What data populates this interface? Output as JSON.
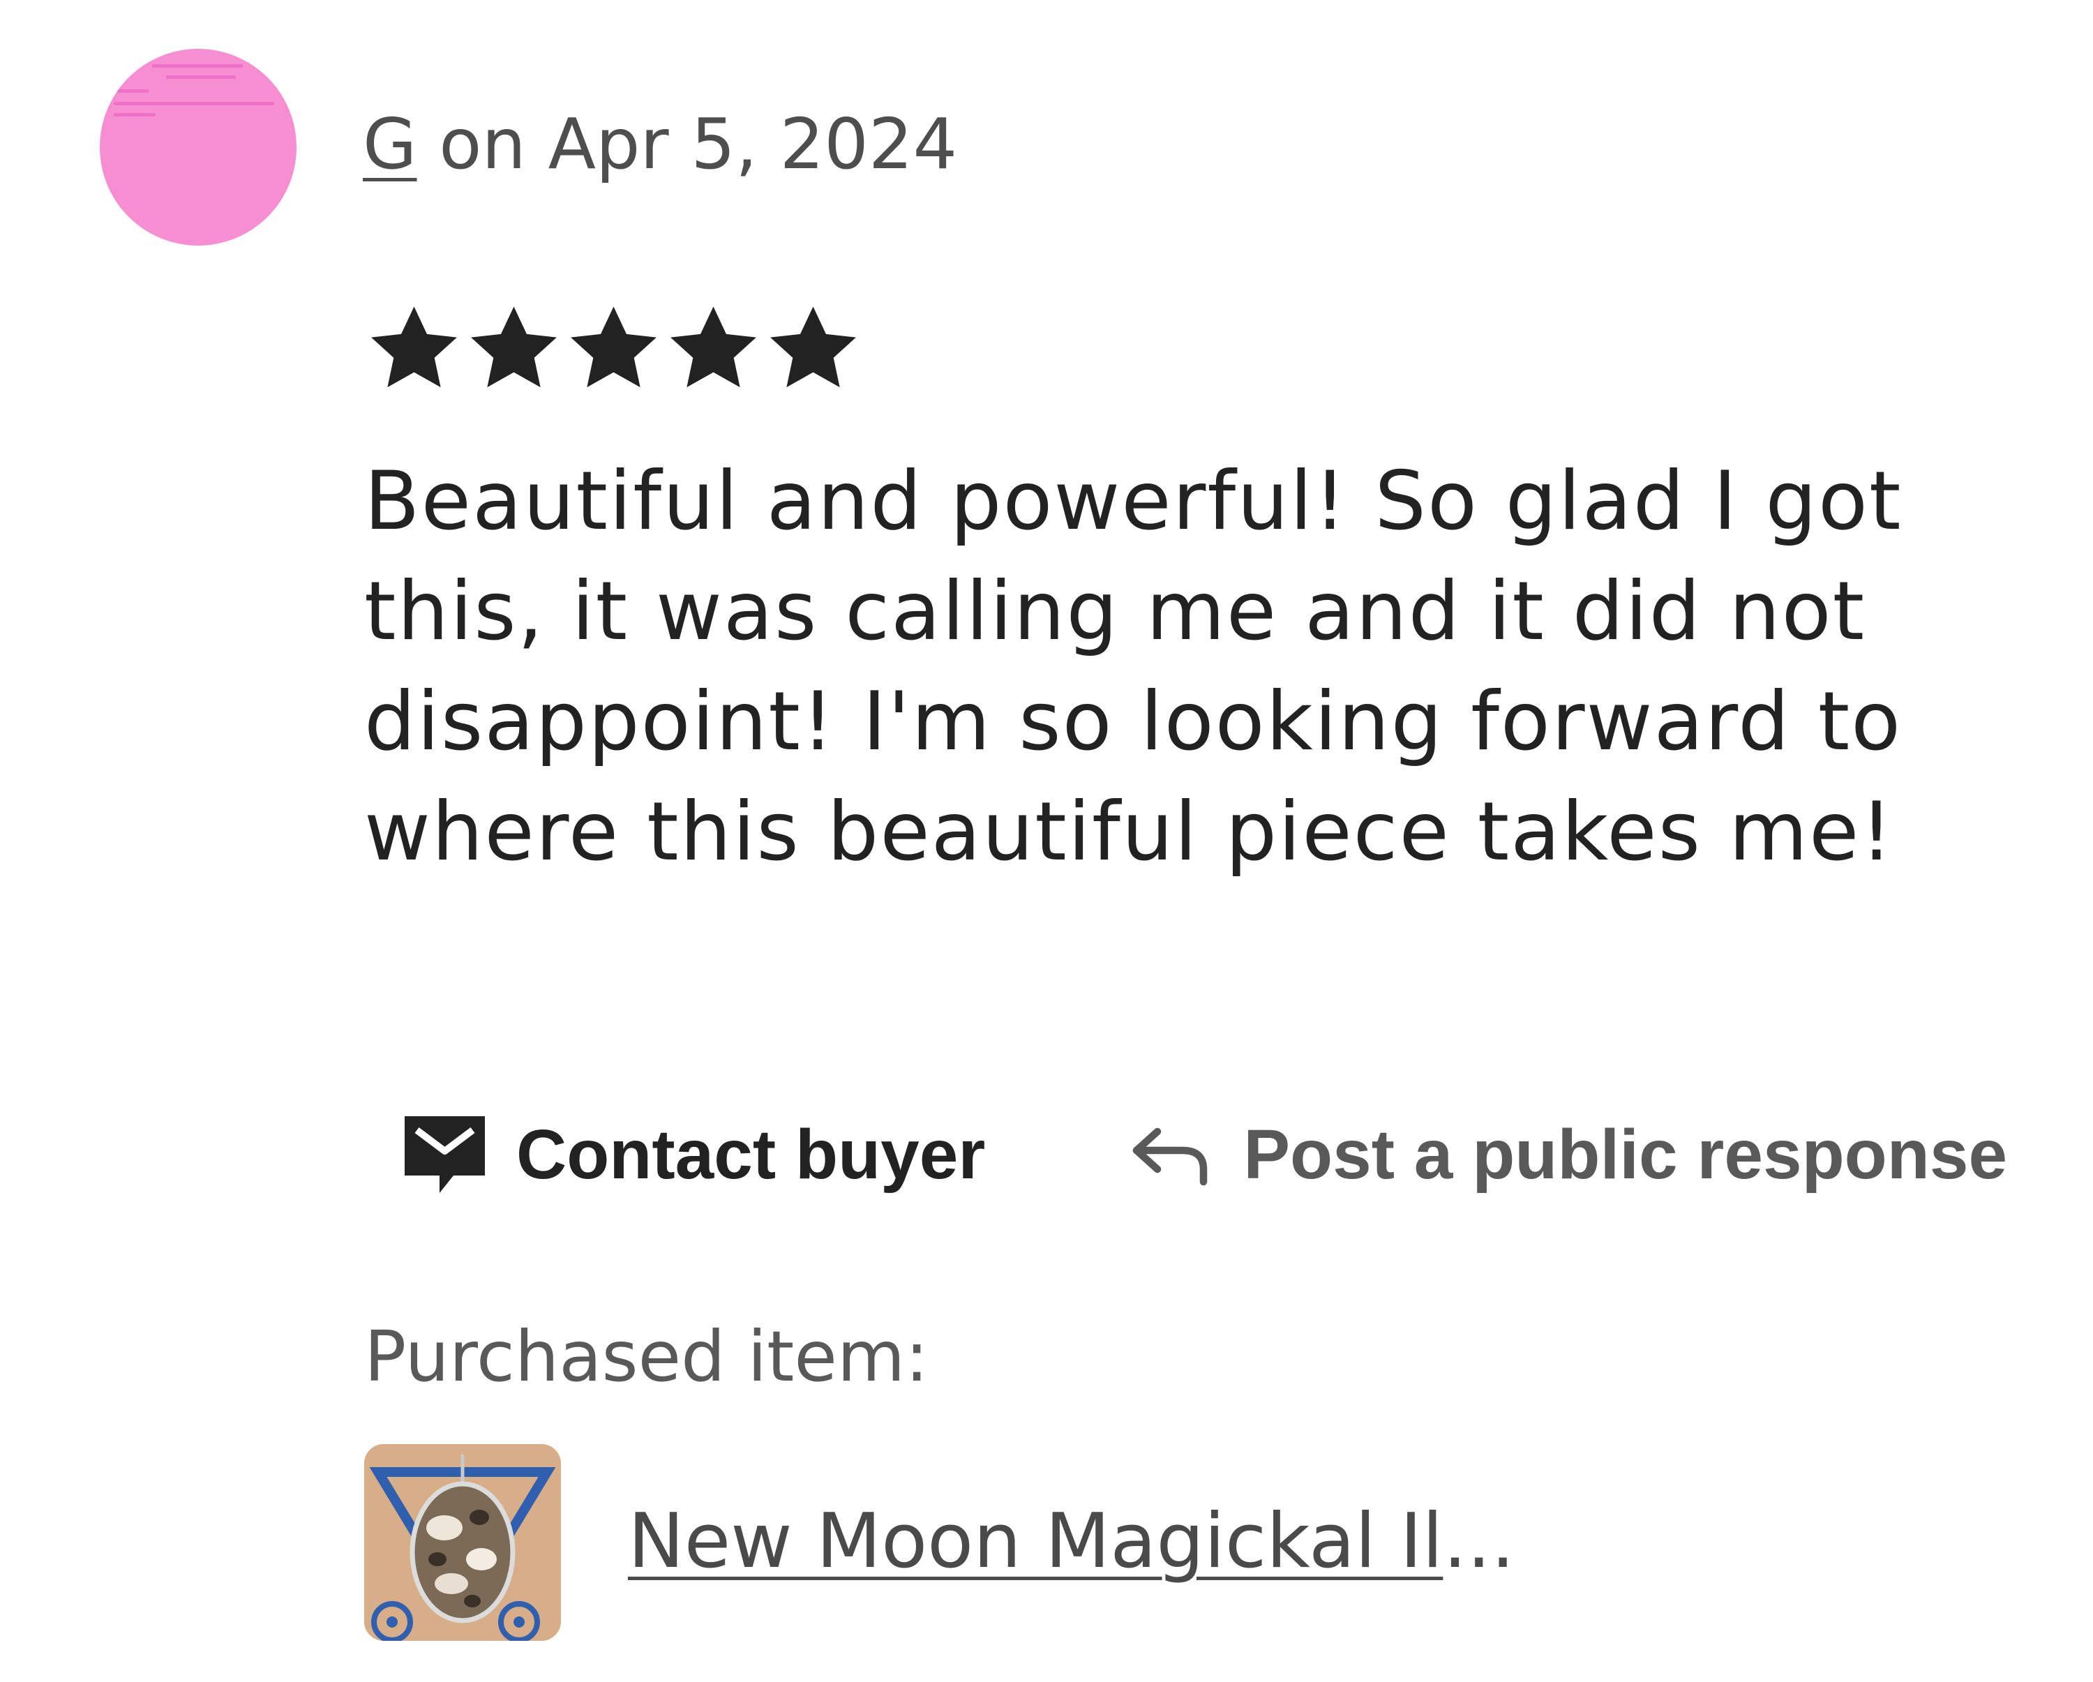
{
  "review": {
    "reviewer_name": "G",
    "date_text": " on Apr 5, 2024",
    "rating": 5,
    "rating_max": 5,
    "text": "Beautiful and powerful! So glad I got this, it was calling me and it did not disappoint! I'm so looking forward to where this beautiful piece takes me!"
  },
  "actions": {
    "contact_label": "Contact buyer",
    "respond_label": "Post a public response"
  },
  "purchase": {
    "label": "Purchased item:",
    "item_title": "New Moon Magickal Il",
    "ellipsis": "..."
  },
  "colors": {
    "avatar_bg": "#f78ed1",
    "star": "#222222",
    "text_dark": "#222222",
    "text_muted": "#595959"
  },
  "icons": {
    "avatar": "avatar-image",
    "star": "star-icon",
    "contact": "message-icon",
    "respond": "reply-arrow-icon"
  }
}
